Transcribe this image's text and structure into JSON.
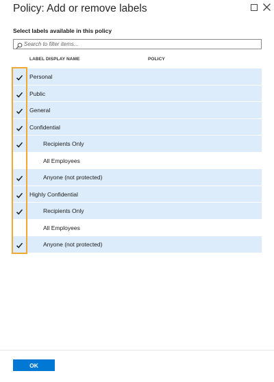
{
  "dialog": {
    "title": "Policy: Add or remove labels",
    "maximize_icon": "maximize-icon",
    "close_icon": "close-icon"
  },
  "section": {
    "label": "Select labels available in this policy"
  },
  "search": {
    "placeholder": "Search to filter items...",
    "value": "",
    "icon": "search-icon"
  },
  "columns": {
    "name": "LABEL DISPLAY NAME",
    "policy": "POLICY"
  },
  "labels": [
    {
      "name": "Personal",
      "level": 0,
      "checked": true
    },
    {
      "name": "Public",
      "level": 0,
      "checked": true
    },
    {
      "name": "General",
      "level": 0,
      "checked": true
    },
    {
      "name": "Confidential",
      "level": 0,
      "checked": true
    },
    {
      "name": "Recipients Only",
      "level": 1,
      "checked": true
    },
    {
      "name": "All Employees",
      "level": 1,
      "checked": false
    },
    {
      "name": "Anyone (not protected)",
      "level": 1,
      "checked": true
    },
    {
      "name": "Highly Confidential",
      "level": 0,
      "checked": true
    },
    {
      "name": "Recipients Only",
      "level": 1,
      "checked": true
    },
    {
      "name": "All Employees",
      "level": 1,
      "checked": false
    },
    {
      "name": "Anyone (not protected)",
      "level": 1,
      "checked": true
    }
  ],
  "colors": {
    "selected_row": "#dcecfa",
    "highlight": "#f0a830",
    "primary": "#0078d4"
  },
  "footer": {
    "ok_label": "OK"
  }
}
